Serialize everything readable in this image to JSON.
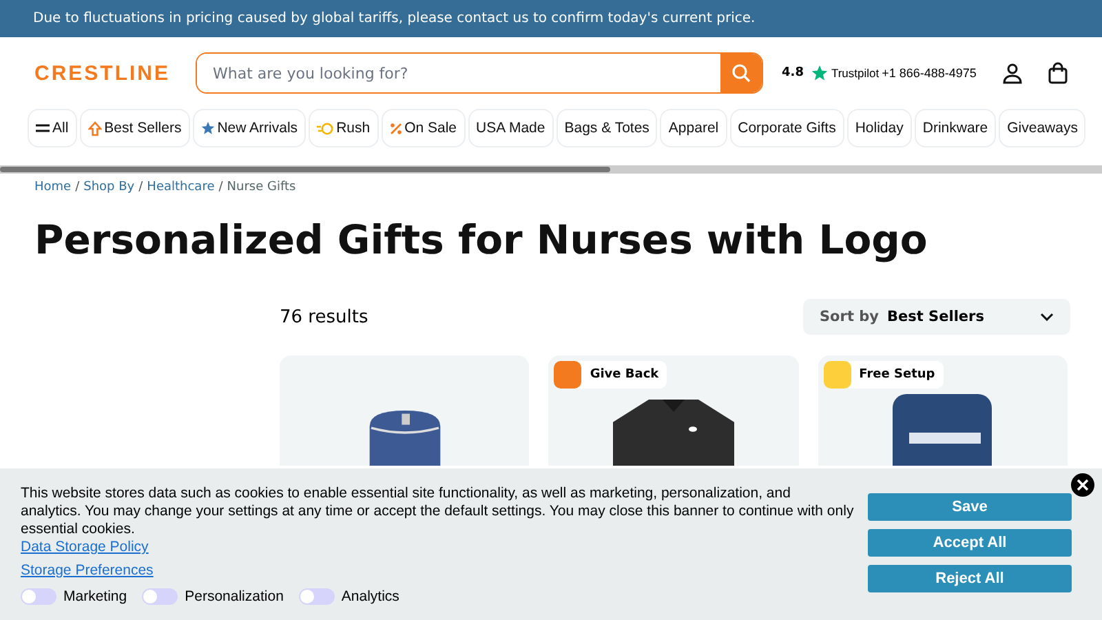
{
  "announcement": "Due to fluctuations in pricing caused by global tariffs, please contact us to confirm today's current price.",
  "header": {
    "logo": "CRESTLINE",
    "search": {
      "placeholder": "What are you looking for?"
    },
    "rating": "4.8",
    "rating_brand": "Trustpilot",
    "phone": "+1 866-488-4975"
  },
  "nav": [
    {
      "label": "All",
      "kind": "menu"
    },
    {
      "label": "Best Sellers",
      "kind": "up"
    },
    {
      "label": "New Arrivals",
      "kind": "star"
    },
    {
      "label": "Rush",
      "kind": "rush"
    },
    {
      "label": "On Sale",
      "kind": "sale"
    },
    {
      "label": "USA Made",
      "kind": "plain"
    },
    {
      "label": "Bags & Totes",
      "kind": "plain"
    },
    {
      "label": "Apparel",
      "kind": "plain"
    },
    {
      "label": "Corporate Gifts",
      "kind": "plain"
    },
    {
      "label": "Holiday",
      "kind": "plain"
    },
    {
      "label": "Drinkware",
      "kind": "plain"
    },
    {
      "label": "Giveaways",
      "kind": "plain"
    }
  ],
  "breadcrumb": [
    "Home",
    "Shop By",
    "Healthcare",
    "Nurse Gifts"
  ],
  "breadcrumb_separator": "/",
  "title": "Personalized Gifts for Nurses with Logo",
  "results": "76 results",
  "sort": {
    "label": "Sort by",
    "value": "Best Sellers"
  },
  "products": [
    {
      "kind": "bag"
    },
    {
      "kind": "jacket",
      "badge": {
        "label": "Give Back",
        "color": "#f47a20"
      }
    },
    {
      "kind": "bottle",
      "badge": {
        "label": "Free Setup",
        "color": "#fdd03b"
      }
    }
  ],
  "cookie": {
    "text": "This website stores data such as cookies to enable essential site functionality, as well as marketing, personalization, and analytics. You may change your settings at any time or accept the default settings. You may close this banner to continue with only essential cookies.",
    "policy_link": "Data Storage Policy",
    "preferences_link": "Storage Preferences",
    "toggles": [
      {
        "label": "Marketing",
        "on": false
      },
      {
        "label": "Personalization",
        "on": false
      },
      {
        "label": "Analytics",
        "on": false
      }
    ],
    "buttons": [
      "Save",
      "Accept All",
      "Reject All"
    ]
  }
}
